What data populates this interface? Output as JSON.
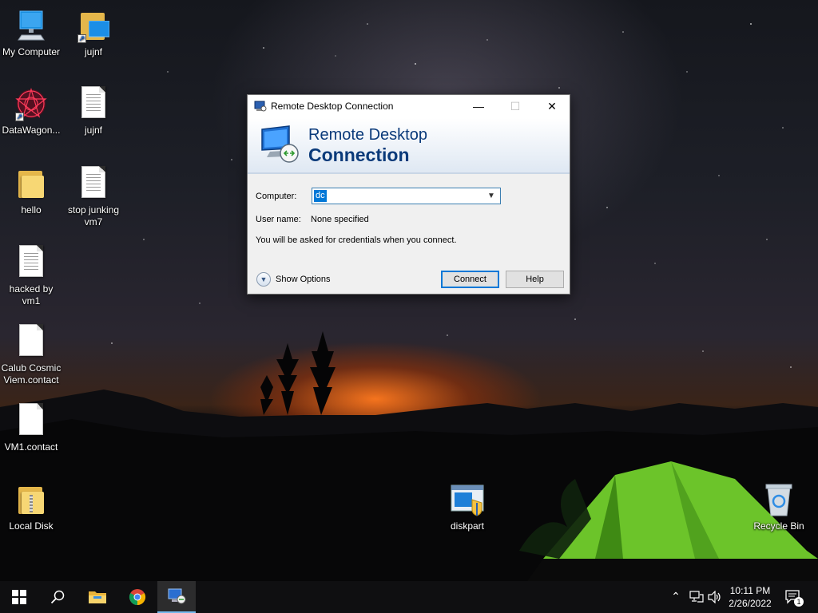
{
  "desktop": {
    "icons": [
      {
        "label": "My Computer",
        "icon": "computer-icon"
      },
      {
        "label": "jujnf",
        "icon": "folder-shortcut-icon"
      },
      {
        "label": "DataWagon...",
        "icon": "datawagon-shortcut-icon"
      },
      {
        "label": "jujnf",
        "icon": "text-document-icon"
      },
      {
        "label": "hello",
        "icon": "folder-icon"
      },
      {
        "label": "stop junking vm7",
        "icon": "text-document-icon"
      },
      {
        "label": "hacked by vm1",
        "icon": "text-document-icon"
      },
      {
        "label": "Calub Cosmic Viem.contact",
        "icon": "contact-file-icon"
      },
      {
        "label": "VM1.contact",
        "icon": "contact-file-icon"
      },
      {
        "label": "Local Disk",
        "icon": "folder-icon"
      },
      {
        "label": "diskpart",
        "icon": "diskpart-icon"
      },
      {
        "label": "Recycle Bin",
        "icon": "recycle-bin-icon"
      }
    ]
  },
  "rdc_window": {
    "title": "Remote Desktop Connection",
    "banner_line1": "Remote Desktop",
    "banner_line2": "Connection",
    "computer_label": "Computer:",
    "computer_value": "dc",
    "username_label": "User name:",
    "username_value": "None specified",
    "info_text": "You will be asked for credentials when you connect.",
    "show_options_label": "Show Options",
    "connect_label": "Connect",
    "help_label": "Help"
  },
  "taskbar": {
    "items": [
      "start-icon",
      "search-icon",
      "file-explorer-icon",
      "chrome-icon",
      "remote-desktop-icon"
    ],
    "active_item": "remote-desktop-icon",
    "tray": [
      "chevron-up-icon",
      "network-icon",
      "volume-icon"
    ],
    "time": "10:11 PM",
    "date": "2/26/2022",
    "notification_count": "1"
  },
  "colors": {
    "accent": "#0078d7",
    "banner_text": "#0a3a7a",
    "taskbar_bg": "#101012"
  }
}
